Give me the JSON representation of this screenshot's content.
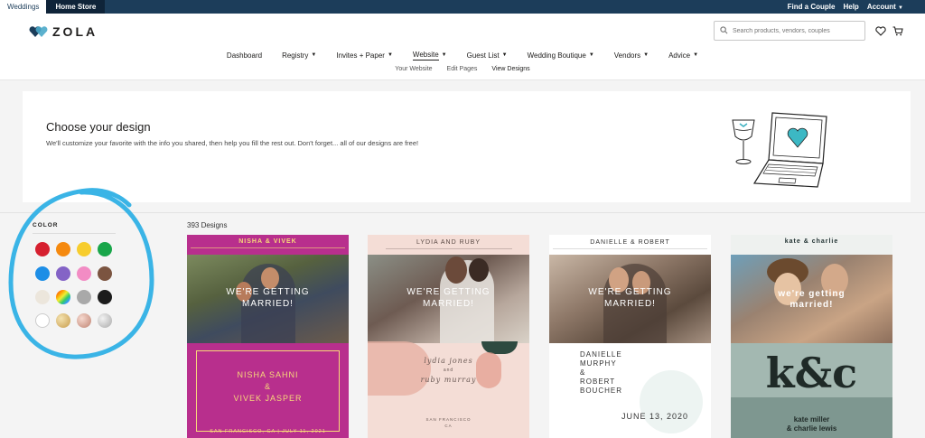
{
  "topbar": {
    "tabs": [
      "Weddings",
      "Home Store"
    ],
    "links": [
      "Find a Couple",
      "Help",
      "Account"
    ]
  },
  "header": {
    "logo_text": "ZOLA",
    "search_placeholder": "Search products, vendors, couples"
  },
  "nav": {
    "items": [
      {
        "label": "Dashboard",
        "dropdown": false
      },
      {
        "label": "Registry",
        "dropdown": true
      },
      {
        "label": "Invites + Paper",
        "dropdown": true
      },
      {
        "label": "Website",
        "dropdown": true
      },
      {
        "label": "Guest List",
        "dropdown": true
      },
      {
        "label": "Wedding Boutique",
        "dropdown": true
      },
      {
        "label": "Vendors",
        "dropdown": true
      },
      {
        "label": "Advice",
        "dropdown": true
      }
    ],
    "subnav": [
      "Your Website",
      "Edit Pages",
      "View Designs"
    ]
  },
  "intro": {
    "title": "Choose your design",
    "text": "We'll customize your favorite with the info you shared, then help you fill the rest out. Don't forget... all of our designs are free!"
  },
  "filters": {
    "color_label": "COLOR",
    "swatches": [
      {
        "name": "red",
        "color": "#d6202f"
      },
      {
        "name": "orange",
        "color": "#f5890f"
      },
      {
        "name": "yellow",
        "color": "#f7cd2e"
      },
      {
        "name": "green",
        "color": "#19a64a"
      },
      {
        "name": "blue",
        "color": "#1d8ee6"
      },
      {
        "name": "purple",
        "color": "#8463c6"
      },
      {
        "name": "pink",
        "color": "#f28cc4"
      },
      {
        "name": "brown",
        "color": "#7b5440"
      },
      {
        "name": "cream",
        "color": "#ece6dc"
      },
      {
        "name": "multicolor",
        "color": "#ffffff"
      },
      {
        "name": "gray",
        "color": "#a9a9a9"
      },
      {
        "name": "black",
        "color": "#1c1c1c"
      },
      {
        "name": "white",
        "color": "#ffffff"
      },
      {
        "name": "gold",
        "color": "#d1b06b"
      },
      {
        "name": "rose-gold",
        "color": "#d5a08f"
      },
      {
        "name": "silver",
        "color": "#c9c9c9"
      }
    ]
  },
  "results": {
    "count_label": "393 Designs"
  },
  "designs": [
    {
      "header": "NISHA & VIVEK",
      "headline": [
        "WE'RE GETTING",
        "MARRIED!"
      ],
      "body": [
        "NISHA SAHNI",
        "&",
        "VIVEK JASPER"
      ],
      "footer": "SAN FRANCISCO, CA  |  JULY 11, 2021",
      "bg": "#b82f8d"
    },
    {
      "header": "LYDIA AND RUBY",
      "headline": [
        "WE'RE GETTING",
        "MARRIED!"
      ],
      "body": [
        "lydia jones",
        "and",
        "ruby murray"
      ],
      "footer": "SAN FRANCISCO",
      "footer2": "CA",
      "bg": "#f4ddd6"
    },
    {
      "header": "DANIELLE & ROBERT",
      "headline": [
        "WE'RE GETTING",
        "MARRIED!"
      ],
      "body": [
        "DANIELLE",
        "MURPHY",
        "&",
        "ROBERT",
        "BOUCHER"
      ],
      "footer": "JUNE 13, 2020",
      "bg": "#ffffff"
    },
    {
      "header": "kate & charlie",
      "headline": [
        "we're getting",
        "married!"
      ],
      "monogram": "k&c",
      "body": [
        "kate miller",
        "& charlie lewis"
      ],
      "bg": "#a3b8b1"
    }
  ]
}
